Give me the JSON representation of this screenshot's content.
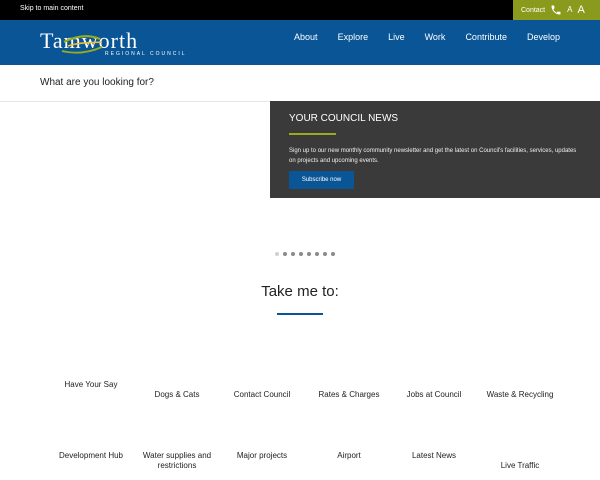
{
  "topbar": {
    "skip_link": "Skip to main content",
    "contact_label": "Contact",
    "font_small": "A",
    "font_large": "A"
  },
  "header": {
    "logo_word": "Tamworth",
    "logo_sub": "REGIONAL COUNCIL",
    "nav": [
      "About",
      "Explore",
      "Live",
      "Work",
      "Contribute",
      "Develop"
    ]
  },
  "search": {
    "prompt": "What are you looking for?"
  },
  "news": {
    "title": "YOUR COUNCIL NEWS",
    "body": "Sign up to our new monthly community newsletter and get the latest on Council's facilities, services, updates on projects and upcoming events.",
    "button": "Subscribe now"
  },
  "carousel": {
    "dot_count": 8,
    "active_index": 0
  },
  "take_me_to": {
    "title": "Take me to:",
    "row1": [
      "Have Your Say",
      "Dogs & Cats",
      "Contact Council",
      "Rates & Charges",
      "Jobs at Council",
      "Waste & Recycling"
    ],
    "row2": [
      "Development Hub",
      "Water supplies and restrictions",
      "Major projects",
      "Airport",
      "Latest News",
      "Live Traffic"
    ]
  },
  "colors": {
    "brand_blue": "#0a5596",
    "accent_olive": "#8a9a1c",
    "news_bg": "#3a3a3a"
  }
}
